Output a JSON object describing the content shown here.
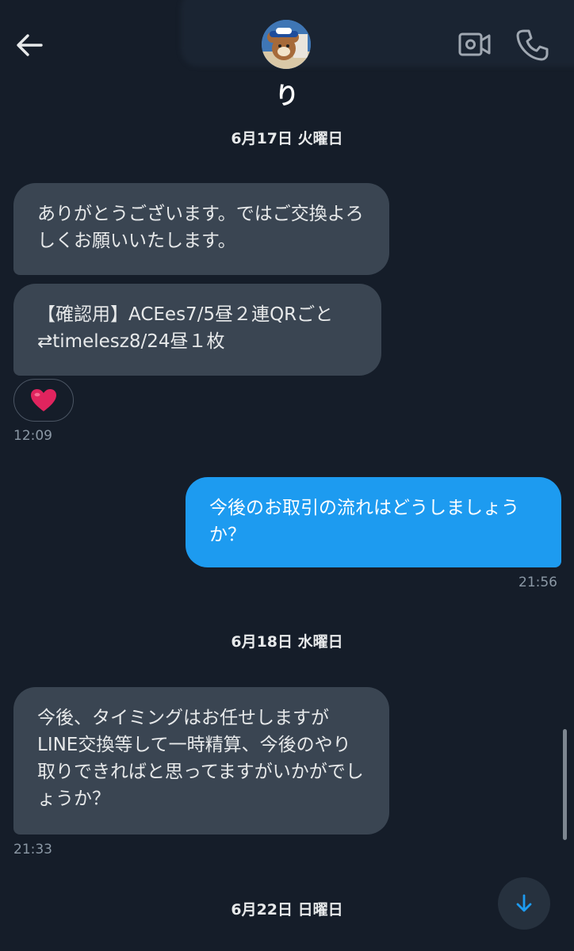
{
  "header": {
    "contact_name": "り"
  },
  "messages": [
    {
      "date": "6月17日 火曜日"
    },
    {
      "incoming_1": "ありがとうございます。ではご交換よろしくお願いいたします。",
      "incoming_2": "【確認用】ACEes7/5昼２連QRごと⇄timelesz8/24昼１枚",
      "reaction": "❤️",
      "time": "12:09"
    },
    {
      "outgoing_1": "今後のお取引の流れはどうしましょうか？",
      "time": "21:56"
    },
    {
      "date": "6月18日 水曜日"
    },
    {
      "incoming_1": "今後、タイミングはお任せしますがLINE交換等して一時精算、今後のやり取りできればと思ってますがいかがでしょうか？",
      "time": "21:33"
    },
    {
      "date": "6月22日 日曜日"
    }
  ],
  "icons": {
    "back": "arrow-left-icon",
    "video": "video-camera-icon",
    "call": "phone-icon",
    "scroll": "arrow-down-icon",
    "reaction": "heart"
  },
  "colors": {
    "background": "#151d29",
    "incoming_bubble": "#3a4552",
    "outgoing_bubble": "#1d9bf0",
    "timestamp": "#8b98a5",
    "reaction_heart": "#e0245e"
  }
}
